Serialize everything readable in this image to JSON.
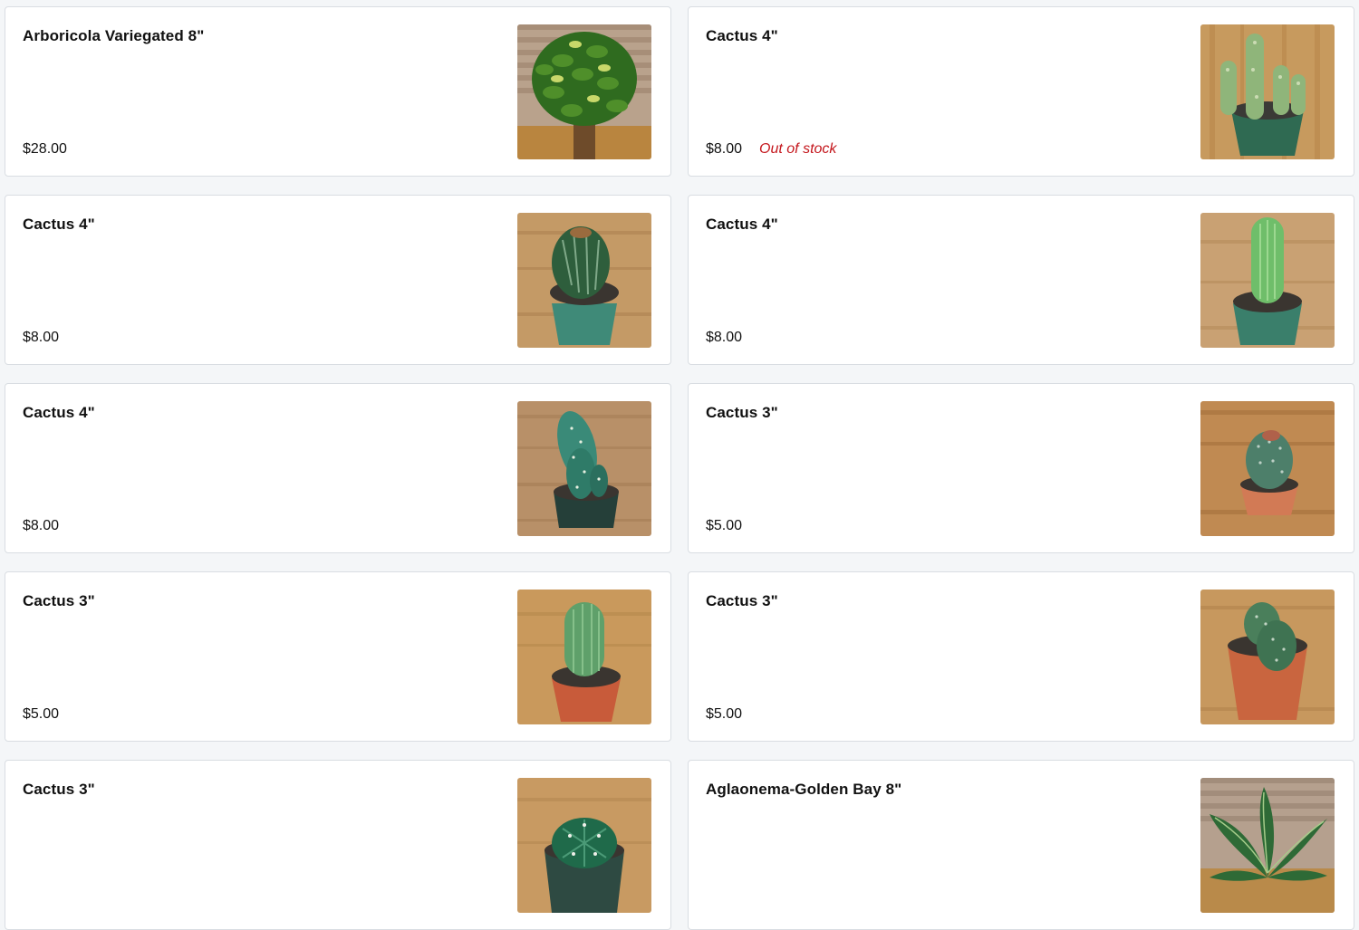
{
  "products": [
    {
      "name": "Arboricola Variegated 8\"",
      "price": "$28.00",
      "stock_status": "",
      "image": "arboricola-plant-photo"
    },
    {
      "name": "Cactus 4\"",
      "price": "$8.00",
      "stock_status": "Out of stock",
      "image": "cactus-cluster-photo"
    },
    {
      "name": "Cactus 4\"",
      "price": "$8.00",
      "stock_status": "",
      "image": "barrel-cactus-photo"
    },
    {
      "name": "Cactus 4\"",
      "price": "$8.00",
      "stock_status": "",
      "image": "column-cactus-photo"
    },
    {
      "name": "Cactus 4\"",
      "price": "$8.00",
      "stock_status": "",
      "image": "paddle-cactus-photo"
    },
    {
      "name": "Cactus 3\"",
      "price": "$5.00",
      "stock_status": "",
      "image": "round-cactus-photo"
    },
    {
      "name": "Cactus 3\"",
      "price": "$5.00",
      "stock_status": "",
      "image": "tall-cactus-photo"
    },
    {
      "name": "Cactus 3\"",
      "price": "$5.00",
      "stock_status": "",
      "image": "twin-cactus-photo"
    },
    {
      "name": "Cactus 3\"",
      "price": "",
      "stock_status": "",
      "image": "star-cactus-photo"
    },
    {
      "name": "Aglaonema-Golden Bay 8\"",
      "price": "",
      "stock_status": "",
      "image": "aglaonema-plant-photo"
    }
  ],
  "colors": {
    "page_background": "#f4f6f8",
    "card_border": "#d9dde2",
    "out_of_stock": "#c4161c"
  }
}
